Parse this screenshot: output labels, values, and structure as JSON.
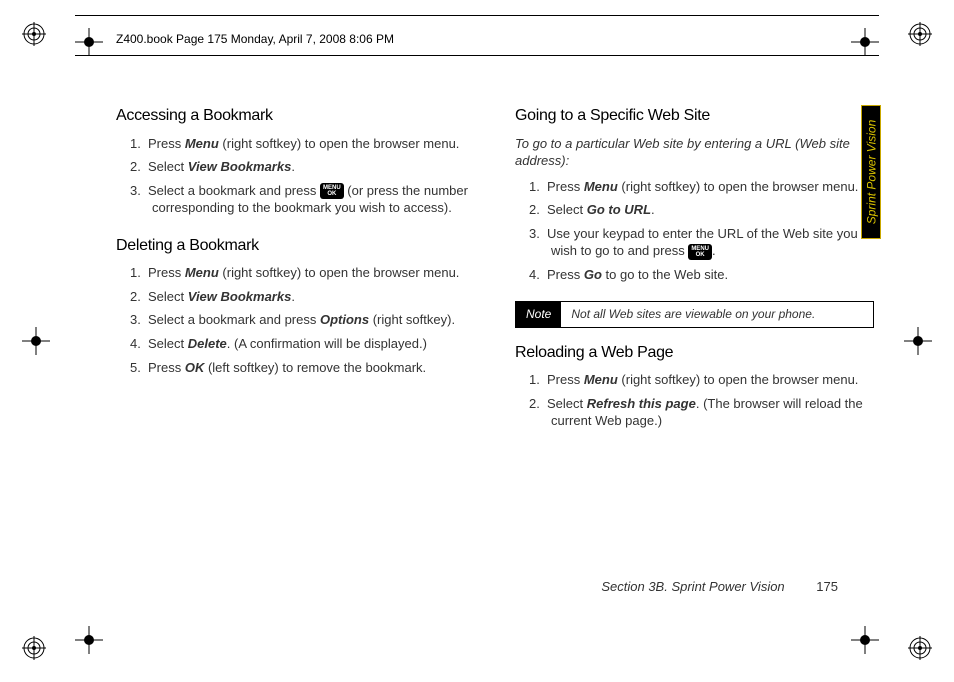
{
  "header": "Z400.book  Page 175  Monday, April 7, 2008  8:06 PM",
  "side_tab": "Sprint Power Vision",
  "footer": {
    "section": "Section 3B. Sprint Power Vision",
    "page": "175"
  },
  "menu_ok": {
    "line1": "MENU",
    "line2": "OK"
  },
  "left": {
    "h1": "Accessing a Bookmark",
    "s1": [
      {
        "n": "1.",
        "pre": "Press ",
        "b": "Menu",
        "post": " (right softkey) to open the browser menu."
      },
      {
        "n": "2.",
        "pre": "Select ",
        "b": "View Bookmarks",
        "post": "."
      },
      {
        "n": "3.",
        "pre": "Select a bookmark and press ",
        "key": true,
        "post": " (or press the number corresponding to the bookmark you wish to access)."
      }
    ],
    "h2": "Deleting a Bookmark",
    "s2": [
      {
        "n": "1.",
        "pre": "Press ",
        "b": "Menu",
        "post": " (right softkey) to open the browser menu."
      },
      {
        "n": "2.",
        "pre": "Select ",
        "b": "View Bookmarks",
        "post": "."
      },
      {
        "n": "3.",
        "pre": "Select a bookmark and press ",
        "b": "Options",
        "post": " (right softkey)."
      },
      {
        "n": "4.",
        "pre": "Select ",
        "b": "Delete",
        "post": ". (A confirmation will be displayed.)"
      },
      {
        "n": "5.",
        "pre": "Press ",
        "b": "OK",
        "post": " (left softkey) to remove the bookmark."
      }
    ]
  },
  "right": {
    "h1": "Going to a Specific Web Site",
    "intro": "To go to a particular Web site by entering a URL (Web site address):",
    "s1": [
      {
        "n": "1.",
        "pre": "Press ",
        "b": "Menu",
        "post": " (right softkey) to open the browser menu."
      },
      {
        "n": "2.",
        "pre": "Select ",
        "b": "Go to URL",
        "post": "."
      },
      {
        "n": "3.",
        "pre": "Use your keypad to enter the URL of the Web site you wish to go to and press ",
        "key": true,
        "post": "."
      },
      {
        "n": "4.",
        "pre": "Press ",
        "b": "Go",
        "post": " to go to the Web site."
      }
    ],
    "note": {
      "label": "Note",
      "text": "Not all Web sites are viewable on your phone."
    },
    "h2": "Reloading a Web Page",
    "s2": [
      {
        "n": "1.",
        "pre": "Press ",
        "b": "Menu",
        "post": " (right softkey) to open the browser menu."
      },
      {
        "n": "2.",
        "pre": "Select ",
        "b": "Refresh this page",
        "post": ". (The browser will reload the current Web page.)"
      }
    ]
  }
}
